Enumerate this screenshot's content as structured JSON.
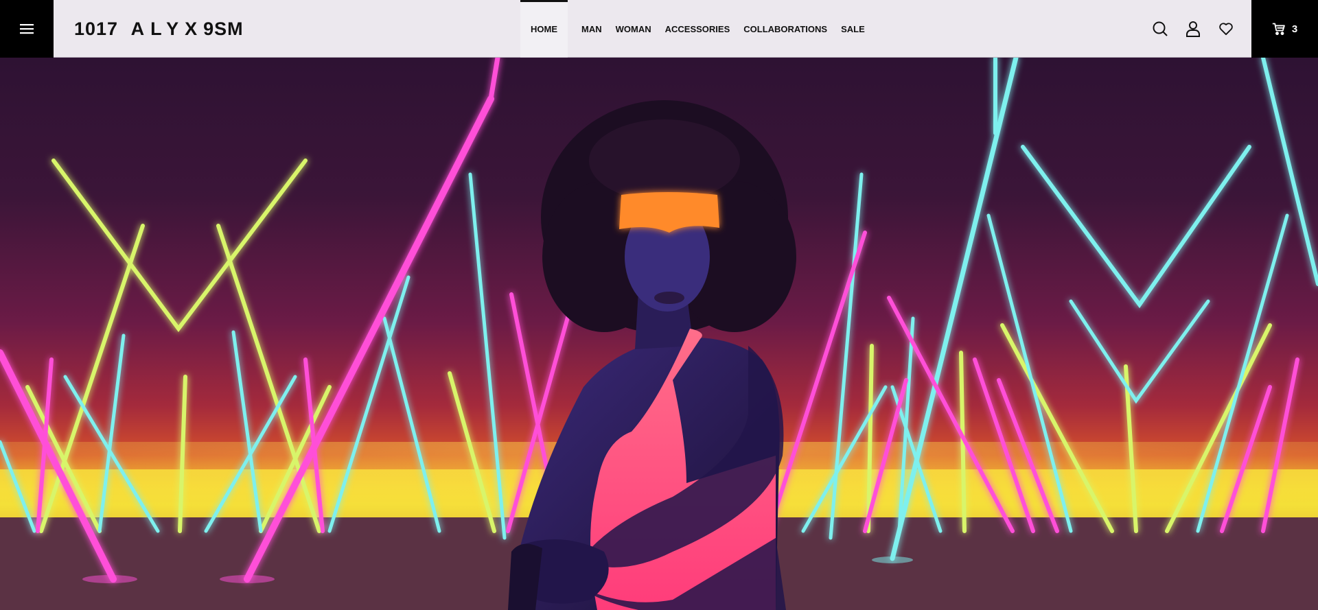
{
  "brand": {
    "logo_part1": "1017",
    "logo_part2": "ALYX",
    "logo_part3": "9SM"
  },
  "nav": {
    "items": [
      {
        "label": "HOME",
        "active": true
      },
      {
        "label": "MAN",
        "active": false
      },
      {
        "label": "WOMAN",
        "active": false
      },
      {
        "label": "ACCESSORIES",
        "active": false
      },
      {
        "label": "COLLABORATIONS",
        "active": false
      },
      {
        "label": "SALE",
        "active": false
      }
    ]
  },
  "header_icons": [
    "menu-icon",
    "search-icon",
    "account-icon",
    "wishlist-heart-icon",
    "cart-icon"
  ],
  "cart": {
    "count": "3"
  },
  "colors": {
    "header_bg": "#ece8ee",
    "black_blocks": "#000000",
    "neon_pink": "#ff4fd8",
    "neon_cyan": "#7ef0ee",
    "neon_lime": "#d8f56a",
    "neon_yellow": "#f6e23a",
    "visor_orange": "#ff8a2a",
    "top_pink": "#ff5a8e"
  }
}
